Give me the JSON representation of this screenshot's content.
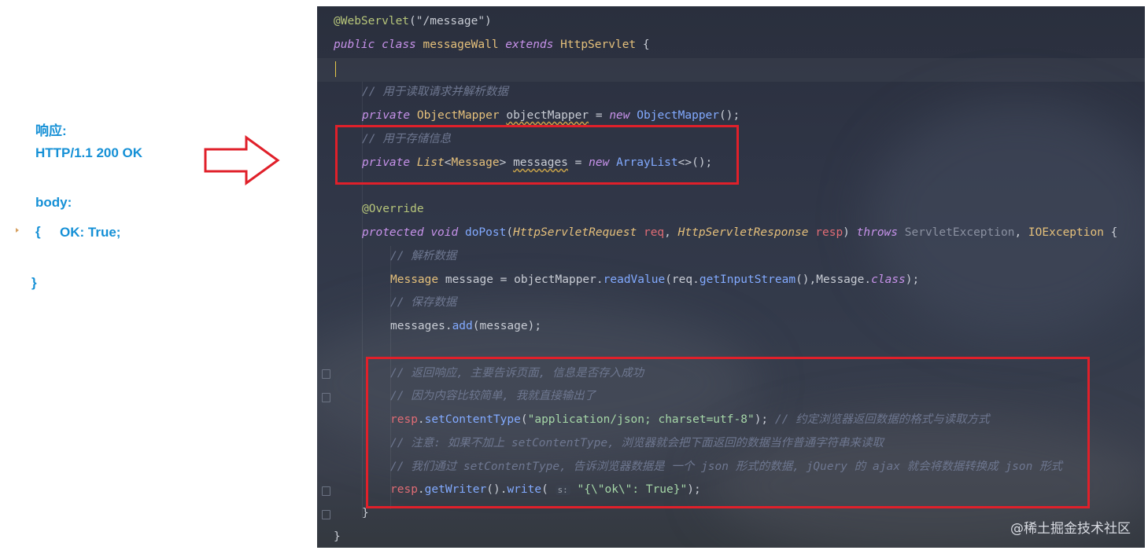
{
  "annotation": {
    "response_label": "响应:",
    "status_line": "HTTP/1.1 200 OK",
    "body_label": "body:",
    "brace_open": "{",
    "body_content": "OK: True;",
    "brace_close": "}"
  },
  "colors": {
    "annotation_text": "#1590d6",
    "highlight_box": "#e0202a",
    "arrow": "#e0202a"
  },
  "code": {
    "l1_annotation": "@WebServlet",
    "l1_arg": "(\"/message\")",
    "l2_public": "public",
    "l2_class": "class",
    "l2_name": "messageWall",
    "l2_extends": "extends",
    "l2_parent": "HttpServlet",
    "l2_brace": " {",
    "l4_comment": "// 用于读取请求并解析数据",
    "l5_private": "private",
    "l5_type": "ObjectMapper",
    "l5_var": "objectMapper",
    "l5_eq": " = ",
    "l5_new": "new",
    "l5_ctor": "ObjectMapper",
    "l5_end": "();",
    "l6_comment": "// 用于存储信息",
    "l7_private": "private",
    "l7_type": "List",
    "l7_generic_open": "<",
    "l7_generic": "Message",
    "l7_generic_close": ">",
    "l7_var": "messages",
    "l7_eq": " = ",
    "l7_new": "new",
    "l7_ctor": "ArrayList",
    "l7_end": "<>();",
    "l9_override": "@Override",
    "l10_protected": "protected",
    "l10_void": "void",
    "l10_method": "doPost",
    "l10_paren": "(",
    "l10_ptype1": "HttpServletRequest",
    "l10_pname1": "req",
    "l10_comma1": ", ",
    "l10_ptype2": "HttpServletResponse",
    "l10_pname2": "resp",
    "l10_close": ") ",
    "l10_throws": "throws",
    "l10_ex1": "ServletException",
    "l10_comma2": ", ",
    "l10_ex2": "IOException",
    "l10_brace": " {",
    "l11_comment": "// 解析数据",
    "l12_type": "Message",
    "l12_rest1": " message = objectMapper.",
    "l12_method": "readValue",
    "l12_rest2": "(req.",
    "l12_method2": "getInputStream",
    "l12_rest3": "(),Message.",
    "l12_class": "class",
    "l12_end": ");",
    "l13_comment": "// 保存数据",
    "l14_var": "messages.",
    "l14_method": "add",
    "l14_end": "(message);",
    "l16_comment": "// 返回响应, 主要告诉页面, 信息是否存入成功",
    "l17_comment": "// 因为内容比较简单, 我就直接输出了",
    "l18_var": "resp",
    "l18_dot": ".",
    "l18_method": "setContentType",
    "l18_paren": "(",
    "l18_str": "\"application/json; charset=utf-8\"",
    "l18_end": "); ",
    "l18_comment": "// 约定浏览器返回数据的格式与读取方式",
    "l19_comment": "// 注意: 如果不加上 setContentType, 浏览器就会把下面返回的数据当作普通字符串来读取",
    "l20_comment": "// 我们通过 setContentType, 告诉浏览器数据是 一个 json 形式的数据, jQuery 的 ajax 就会将数据转换成 json 形式",
    "l21_var": "resp",
    "l21_dot1": ".",
    "l21_method1": "getWriter",
    "l21_mid": "().",
    "l21_method2": "write",
    "l21_paren": "( ",
    "l21_hint": "s:",
    "l21_str": "\"{\\\"ok\\\": True}\"",
    "l21_end": ");",
    "l22_brace": "}",
    "l23_brace": "}"
  },
  "watermark": "@稀土掘金技术社区"
}
